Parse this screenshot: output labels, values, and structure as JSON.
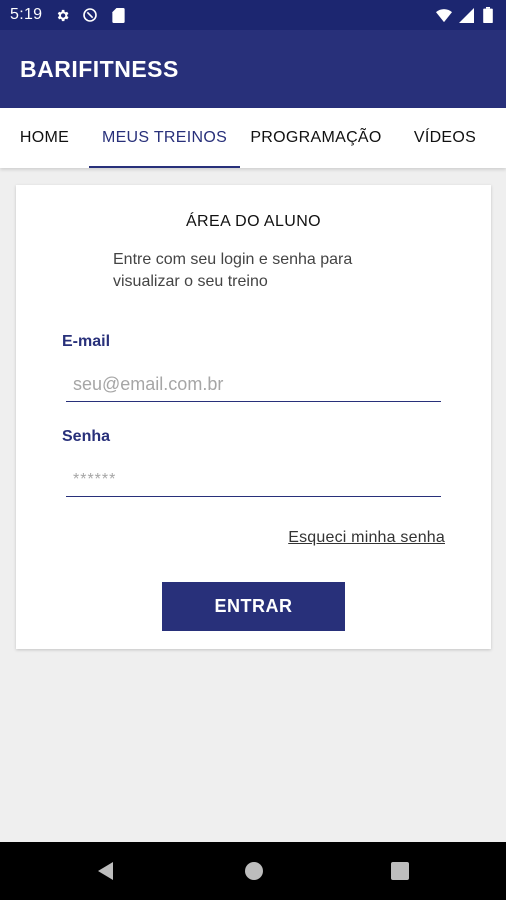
{
  "status_bar": {
    "time": "5:19",
    "left_icons": [
      "gear-icon",
      "data-saver-icon",
      "sd-card-icon"
    ],
    "right_icons": [
      "wifi-icon",
      "cell-signal-icon",
      "battery-icon"
    ]
  },
  "app_bar": {
    "title": "BARIFITNESS"
  },
  "tabs": [
    {
      "label": "HOME",
      "active": false
    },
    {
      "label": "MEUS TREINOS",
      "active": true
    },
    {
      "label": "PROGRAMAÇÃO",
      "active": false
    },
    {
      "label": "VÍDEOS",
      "active": false
    }
  ],
  "login_card": {
    "title": "ÁREA DO ALUNO",
    "subtitle": "Entre com seu login e senha para visualizar o seu treino",
    "email_label": "E-mail",
    "email_placeholder": "seu@email.com.br",
    "email_value": "",
    "password_label": "Senha",
    "password_placeholder": "******",
    "password_value": "",
    "forgot_link": "Esqueci minha senha",
    "submit_label": "ENTRAR"
  },
  "nav_bar": {
    "buttons": [
      "back-icon",
      "home-icon",
      "recents-icon"
    ]
  },
  "colors": {
    "status_bar": "#1c2670",
    "primary": "#28307a",
    "background": "#efefef",
    "card": "#ffffff"
  }
}
